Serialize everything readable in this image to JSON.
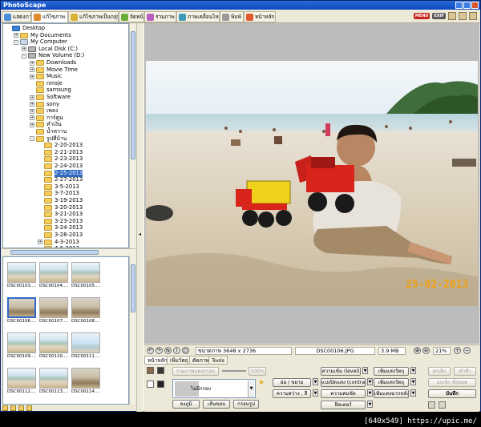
{
  "window": {
    "title": "PhotoScape"
  },
  "tabs": [
    {
      "label": "แสดงภาพ",
      "color": "#4b8fd9"
    },
    {
      "label": "แก้ไขภาพ",
      "color": "#e08a2c"
    },
    {
      "label": "แก้ไขภาพเป็นกลุ่ม",
      "color": "#d8b232"
    },
    {
      "label": "จัดหน้า",
      "color": "#6cab3c"
    },
    {
      "label": "รวมภาพ",
      "color": "#b85fbf"
    },
    {
      "label": "ภาพเคลื่อนไหว",
      "color": "#3c9bb8"
    },
    {
      "label": "พิมพ์",
      "color": "#999999"
    },
    {
      "label": "หน้าหลัก",
      "color": "#e0582c"
    }
  ],
  "top_badges": [
    "MENU",
    "EXIF"
  ],
  "tree": [
    {
      "label": "Desktop",
      "indent": 0,
      "icon": "desk",
      "exp": ""
    },
    {
      "label": "My Documents",
      "indent": 1,
      "icon": "fold",
      "exp": "+"
    },
    {
      "label": "My Computer",
      "indent": 1,
      "icon": "pc",
      "exp": "-"
    },
    {
      "label": "Local Disk (C:)",
      "indent": 2,
      "icon": "drive",
      "exp": "+"
    },
    {
      "label": "New Volume (D:)",
      "indent": 2,
      "icon": "drive",
      "exp": "-"
    },
    {
      "label": "Downloads",
      "indent": 3,
      "icon": "fold",
      "exp": "+"
    },
    {
      "label": "Movie Time",
      "indent": 3,
      "icon": "fold",
      "exp": "+"
    },
    {
      "label": "Music",
      "indent": 3,
      "icon": "fold",
      "exp": "+"
    },
    {
      "label": "nrroje",
      "indent": 3,
      "icon": "fold",
      "exp": ""
    },
    {
      "label": "samsung",
      "indent": 3,
      "icon": "fold",
      "exp": ""
    },
    {
      "label": "Software",
      "indent": 3,
      "icon": "fold",
      "exp": "+"
    },
    {
      "label": "sony",
      "indent": 3,
      "icon": "fold",
      "exp": "+"
    },
    {
      "label": "เพลง",
      "indent": 3,
      "icon": "fold",
      "exp": "+"
    },
    {
      "label": "การ์ตูน",
      "indent": 3,
      "icon": "fold",
      "exp": "+"
    },
    {
      "label": "ทำเงิน",
      "indent": 3,
      "icon": "fold",
      "exp": "+"
    },
    {
      "label": "น้ำหวาน",
      "indent": 3,
      "icon": "fold",
      "exp": ""
    },
    {
      "label": "รูปที่บ้าน",
      "indent": 3,
      "icon": "fold",
      "exp": "-"
    },
    {
      "label": "2-20-2013",
      "indent": 4,
      "icon": "fold",
      "exp": ""
    },
    {
      "label": "2-21-2013",
      "indent": 4,
      "icon": "fold",
      "exp": ""
    },
    {
      "label": "2-23-2013",
      "indent": 4,
      "icon": "fold",
      "exp": ""
    },
    {
      "label": "2-24-2013",
      "indent": 4,
      "icon": "fold",
      "exp": ""
    },
    {
      "label": "2-25-2013",
      "indent": 4,
      "icon": "fold",
      "exp": "",
      "selected": true
    },
    {
      "label": "2-27-2013",
      "indent": 4,
      "icon": "fold",
      "exp": ""
    },
    {
      "label": "3-5-2013",
      "indent": 4,
      "icon": "fold",
      "exp": ""
    },
    {
      "label": "3-7-2013",
      "indent": 4,
      "icon": "fold",
      "exp": ""
    },
    {
      "label": "3-19-2013",
      "indent": 4,
      "icon": "fold",
      "exp": ""
    },
    {
      "label": "3-20-2013",
      "indent": 4,
      "icon": "fold",
      "exp": ""
    },
    {
      "label": "3-21-2013",
      "indent": 4,
      "icon": "fold",
      "exp": ""
    },
    {
      "label": "3-23-2013",
      "indent": 4,
      "icon": "fold",
      "exp": ""
    },
    {
      "label": "3-24-2013",
      "indent": 4,
      "icon": "fold",
      "exp": ""
    },
    {
      "label": "3-28-2013",
      "indent": 4,
      "icon": "fold",
      "exp": ""
    },
    {
      "label": "4-3-2013",
      "indent": 4,
      "icon": "fold",
      "exp": "+"
    },
    {
      "label": "4-6-2013",
      "indent": 4,
      "icon": "fold",
      "exp": ""
    }
  ],
  "thumbnails": [
    {
      "name": "DSC00103....",
      "tone": "beach"
    },
    {
      "name": "DSC00104....",
      "tone": "beach"
    },
    {
      "name": "DSC00105....",
      "tone": "beach"
    },
    {
      "name": "DSC00106....",
      "tone": "sand",
      "selected": true
    },
    {
      "name": "DSC00107....",
      "tone": "sand"
    },
    {
      "name": "DSC00108....",
      "tone": "sand"
    },
    {
      "name": "DSC00109....",
      "tone": "beach"
    },
    {
      "name": "DSC00110....",
      "tone": "beach"
    },
    {
      "name": "DSC00111....",
      "tone": "sky"
    },
    {
      "name": "DSC00112....",
      "tone": "beach"
    },
    {
      "name": "DSC00113....",
      "tone": "beach"
    },
    {
      "name": "DSC00114....",
      "tone": "sand"
    }
  ],
  "photo": {
    "date_stamp": "25-02-2013"
  },
  "status": {
    "dimensions": "ขนาดภาพ 3648 x 2736",
    "filename": "DSC00106.JPG",
    "filesize": "3.9 MB",
    "zoom": "21%"
  },
  "edit_tabs": [
    "หน้าหลัก",
    "เพิ่มวัตถุ",
    "ตัดภาพ",
    "Tools"
  ],
  "edit_panel": {
    "rounded_label": "รวมภาพแดงกรอบ",
    "slider_value": "100%",
    "frame_label": "ไม่มีกรอบ",
    "buttons_row1": [
      "ความเข้ม (level)",
      "เพิ่มแสงวัตถุ"
    ],
    "buttons_left": [
      "ย่อ / ขยาย",
      "ความสว่าง , สี"
    ],
    "buttons_mid": [
      "แบ่งปิดแต่ง (contrast)",
      "ความคมชัด"
    ],
    "buttons_right": [
      "เพิ่มแสงวัตถุ",
      "เพิ่มแสงฉากหลัง"
    ],
    "button_filter": "ฟิลเตอร์",
    "bottom_buttons": [
      "ลงภูมิ",
      "เส้นขอบ",
      "กรอบรูป"
    ],
    "undo": "ยกเลิก",
    "redo": "ทำซ้ำ",
    "undo_all": "ยกเลิก ทั้งหมด",
    "save": "บันทึก"
  },
  "watermark": "[640x549] https://upic.me/"
}
